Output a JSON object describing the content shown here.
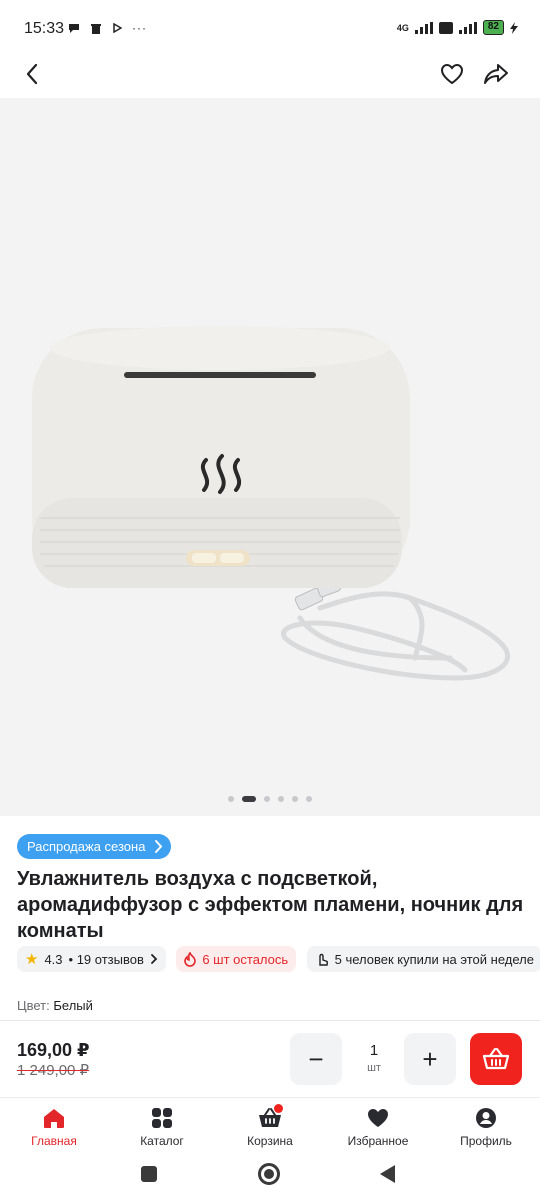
{
  "status_bar": {
    "time": "15:33",
    "network": "4G",
    "battery": "82"
  },
  "header": {
    "back_icon": "chevron-left-icon",
    "favorite_icon": "heart-outline-icon",
    "share_icon": "share-icon"
  },
  "gallery": {
    "image_count": 6,
    "active_index": 1
  },
  "product": {
    "promo_badge": "Распродажа сезона",
    "title": "Увлажнитель воздуха с подсветкой, аромадиффузор с эффектом пламени, ночник для комнаты",
    "rating": "4.3",
    "reviews": "• 19 отзывов",
    "stock": "6 шт осталось",
    "bought": "5 человек купили на этой неделе",
    "color_label": "Цвет:",
    "color_value": "Белый"
  },
  "purchase": {
    "price": "169,00 ₽",
    "old_price": "1 249,00 ₽",
    "quantity": "1",
    "unit": "шт",
    "minus_label": "−",
    "plus_label": "+"
  },
  "bottom_nav": {
    "items": [
      {
        "label": "Главная",
        "icon": "home-icon",
        "active": true
      },
      {
        "label": "Каталог",
        "icon": "catalog-grid-icon",
        "active": false
      },
      {
        "label": "Корзина",
        "icon": "cart-icon",
        "active": false
      },
      {
        "label": "Избранное",
        "icon": "heart-icon",
        "active": false
      },
      {
        "label": "Профиль",
        "icon": "profile-icon",
        "active": false
      }
    ]
  },
  "colors": {
    "accent_red": "#f1231e",
    "promo_blue": "#3ea0f0",
    "rating_star": "#f5b400"
  }
}
